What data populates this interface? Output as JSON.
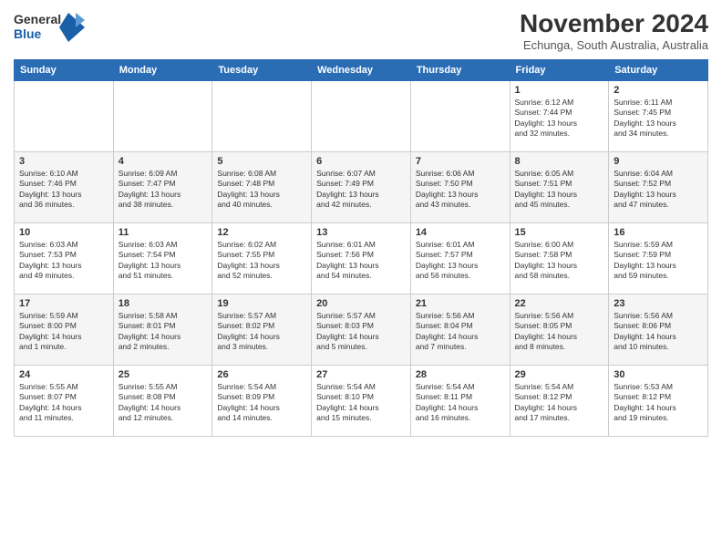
{
  "logo": {
    "line1": "General",
    "line2": "Blue"
  },
  "title": "November 2024",
  "subtitle": "Echunga, South Australia, Australia",
  "weekdays": [
    "Sunday",
    "Monday",
    "Tuesday",
    "Wednesday",
    "Thursday",
    "Friday",
    "Saturday"
  ],
  "weeks": [
    [
      {
        "day": "",
        "info": ""
      },
      {
        "day": "",
        "info": ""
      },
      {
        "day": "",
        "info": ""
      },
      {
        "day": "",
        "info": ""
      },
      {
        "day": "",
        "info": ""
      },
      {
        "day": "1",
        "info": "Sunrise: 6:12 AM\nSunset: 7:44 PM\nDaylight: 13 hours\nand 32 minutes."
      },
      {
        "day": "2",
        "info": "Sunrise: 6:11 AM\nSunset: 7:45 PM\nDaylight: 13 hours\nand 34 minutes."
      }
    ],
    [
      {
        "day": "3",
        "info": "Sunrise: 6:10 AM\nSunset: 7:46 PM\nDaylight: 13 hours\nand 36 minutes."
      },
      {
        "day": "4",
        "info": "Sunrise: 6:09 AM\nSunset: 7:47 PM\nDaylight: 13 hours\nand 38 minutes."
      },
      {
        "day": "5",
        "info": "Sunrise: 6:08 AM\nSunset: 7:48 PM\nDaylight: 13 hours\nand 40 minutes."
      },
      {
        "day": "6",
        "info": "Sunrise: 6:07 AM\nSunset: 7:49 PM\nDaylight: 13 hours\nand 42 minutes."
      },
      {
        "day": "7",
        "info": "Sunrise: 6:06 AM\nSunset: 7:50 PM\nDaylight: 13 hours\nand 43 minutes."
      },
      {
        "day": "8",
        "info": "Sunrise: 6:05 AM\nSunset: 7:51 PM\nDaylight: 13 hours\nand 45 minutes."
      },
      {
        "day": "9",
        "info": "Sunrise: 6:04 AM\nSunset: 7:52 PM\nDaylight: 13 hours\nand 47 minutes."
      }
    ],
    [
      {
        "day": "10",
        "info": "Sunrise: 6:03 AM\nSunset: 7:53 PM\nDaylight: 13 hours\nand 49 minutes."
      },
      {
        "day": "11",
        "info": "Sunrise: 6:03 AM\nSunset: 7:54 PM\nDaylight: 13 hours\nand 51 minutes."
      },
      {
        "day": "12",
        "info": "Sunrise: 6:02 AM\nSunset: 7:55 PM\nDaylight: 13 hours\nand 52 minutes."
      },
      {
        "day": "13",
        "info": "Sunrise: 6:01 AM\nSunset: 7:56 PM\nDaylight: 13 hours\nand 54 minutes."
      },
      {
        "day": "14",
        "info": "Sunrise: 6:01 AM\nSunset: 7:57 PM\nDaylight: 13 hours\nand 56 minutes."
      },
      {
        "day": "15",
        "info": "Sunrise: 6:00 AM\nSunset: 7:58 PM\nDaylight: 13 hours\nand 58 minutes."
      },
      {
        "day": "16",
        "info": "Sunrise: 5:59 AM\nSunset: 7:59 PM\nDaylight: 13 hours\nand 59 minutes."
      }
    ],
    [
      {
        "day": "17",
        "info": "Sunrise: 5:59 AM\nSunset: 8:00 PM\nDaylight: 14 hours\nand 1 minute."
      },
      {
        "day": "18",
        "info": "Sunrise: 5:58 AM\nSunset: 8:01 PM\nDaylight: 14 hours\nand 2 minutes."
      },
      {
        "day": "19",
        "info": "Sunrise: 5:57 AM\nSunset: 8:02 PM\nDaylight: 14 hours\nand 3 minutes."
      },
      {
        "day": "20",
        "info": "Sunrise: 5:57 AM\nSunset: 8:03 PM\nDaylight: 14 hours\nand 5 minutes."
      },
      {
        "day": "21",
        "info": "Sunrise: 5:56 AM\nSunset: 8:04 PM\nDaylight: 14 hours\nand 7 minutes."
      },
      {
        "day": "22",
        "info": "Sunrise: 5:56 AM\nSunset: 8:05 PM\nDaylight: 14 hours\nand 8 minutes."
      },
      {
        "day": "23",
        "info": "Sunrise: 5:56 AM\nSunset: 8:06 PM\nDaylight: 14 hours\nand 10 minutes."
      }
    ],
    [
      {
        "day": "24",
        "info": "Sunrise: 5:55 AM\nSunset: 8:07 PM\nDaylight: 14 hours\nand 11 minutes."
      },
      {
        "day": "25",
        "info": "Sunrise: 5:55 AM\nSunset: 8:08 PM\nDaylight: 14 hours\nand 12 minutes."
      },
      {
        "day": "26",
        "info": "Sunrise: 5:54 AM\nSunset: 8:09 PM\nDaylight: 14 hours\nand 14 minutes."
      },
      {
        "day": "27",
        "info": "Sunrise: 5:54 AM\nSunset: 8:10 PM\nDaylight: 14 hours\nand 15 minutes."
      },
      {
        "day": "28",
        "info": "Sunrise: 5:54 AM\nSunset: 8:11 PM\nDaylight: 14 hours\nand 16 minutes."
      },
      {
        "day": "29",
        "info": "Sunrise: 5:54 AM\nSunset: 8:12 PM\nDaylight: 14 hours\nand 17 minutes."
      },
      {
        "day": "30",
        "info": "Sunrise: 5:53 AM\nSunset: 8:12 PM\nDaylight: 14 hours\nand 19 minutes."
      }
    ]
  ]
}
